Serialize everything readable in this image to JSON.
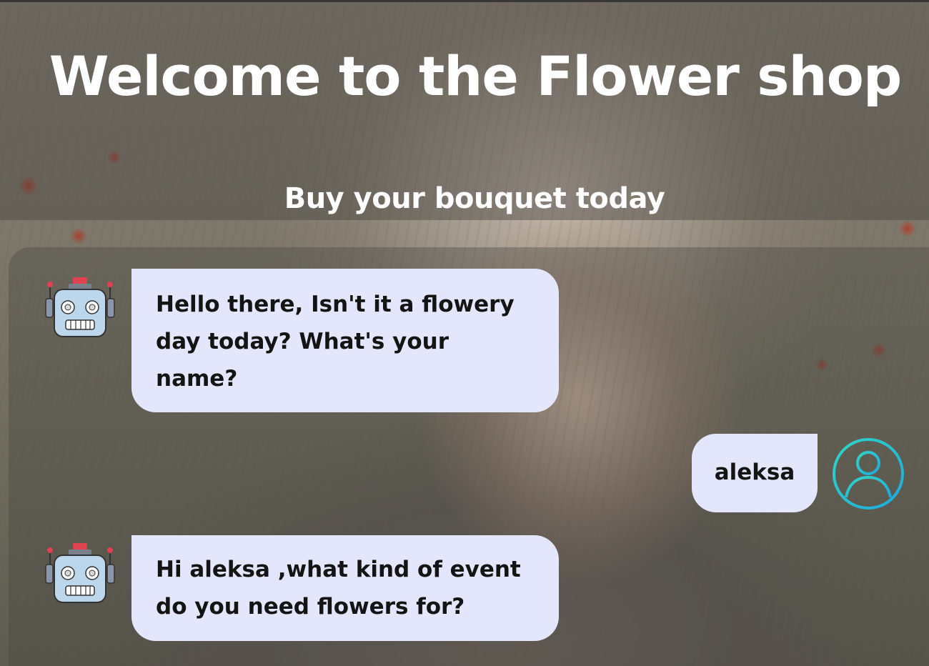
{
  "header": {
    "title": "Welcome to the Flower shop",
    "subtitle": "Buy your bouquet today"
  },
  "chat": {
    "messages": [
      {
        "sender": "bot",
        "avatar": "robot-icon",
        "text": "Hello there, Isn't it a flowery day today? What's your name?"
      },
      {
        "sender": "user",
        "avatar": "user-profile-icon",
        "text": "aleksa"
      },
      {
        "sender": "bot",
        "avatar": "robot-icon",
        "text": "Hi aleksa ,what kind of event do you need flowers for?"
      }
    ]
  },
  "colors": {
    "bubble": "#e4e6fb",
    "user_avatar_accent": "#1fc6d4"
  }
}
